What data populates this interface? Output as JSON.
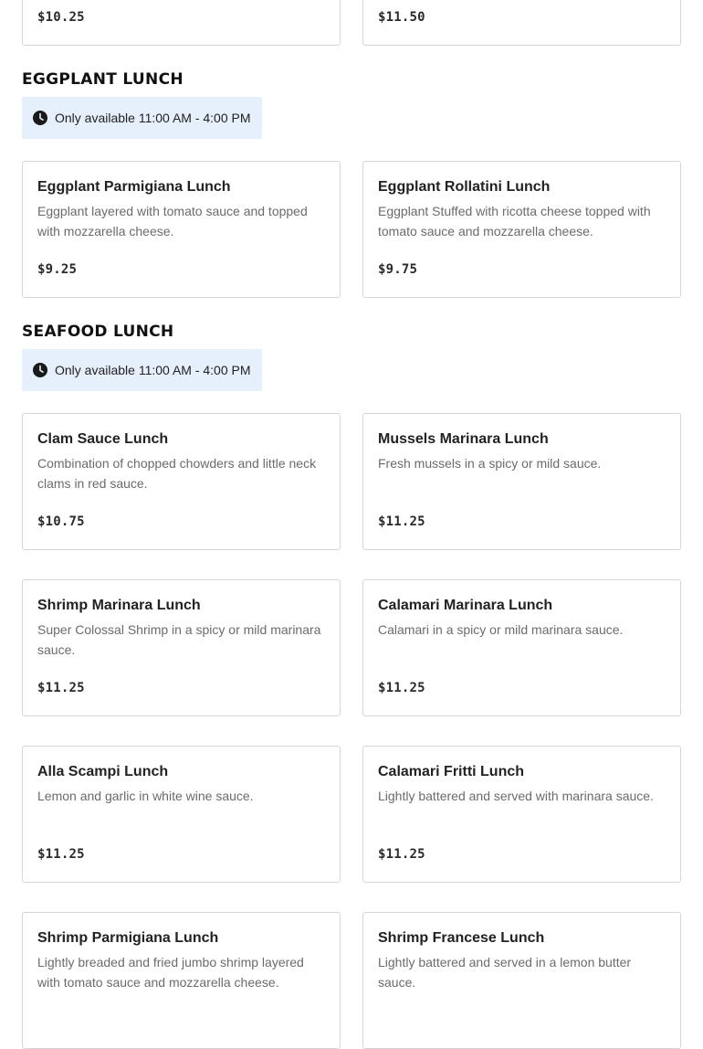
{
  "top_row": [
    {
      "price": "$10.25"
    },
    {
      "price": "$11.50"
    }
  ],
  "sections": [
    {
      "title": "EGGPLANT LUNCH",
      "availability": "Only available 11:00 AM - 4:00 PM",
      "items": [
        {
          "name": "Eggplant Parmigiana Lunch",
          "desc": "Eggplant layered with tomato sauce and topped with mozzarella cheese.",
          "price": "$9.25"
        },
        {
          "name": "Eggplant Rollatini Lunch",
          "desc": "Eggplant Stuffed with ricotta cheese topped with tomato sauce and mozzarella cheese.",
          "price": "$9.75"
        }
      ]
    },
    {
      "title": "SEAFOOD LUNCH",
      "availability": "Only available 11:00 AM - 4:00 PM",
      "items": [
        {
          "name": "Clam Sauce Lunch",
          "desc": "Combination of chopped chowders and little neck clams in red sauce.",
          "price": "$10.75"
        },
        {
          "name": "Mussels Marinara Lunch",
          "desc": "Fresh mussels in a spicy or mild sauce.",
          "price": "$11.25"
        },
        {
          "name": "Shrimp Marinara Lunch",
          "desc": "Super Colossal Shrimp in a spicy or mild marinara sauce.",
          "price": "$11.25"
        },
        {
          "name": "Calamari Marinara Lunch",
          "desc": "Calamari in a spicy or mild marinara sauce.",
          "price": "$11.25"
        },
        {
          "name": "Alla Scampi Lunch",
          "desc": "Lemon and garlic in white wine sauce.",
          "price": "$11.25"
        },
        {
          "name": "Calamari Fritti Lunch",
          "desc": "Lightly battered and served with marinara sauce.",
          "price": "$11.25"
        },
        {
          "name": "Shrimp Parmigiana Lunch",
          "desc": "Lightly breaded and fried jumbo shrimp layered with tomato sauce and mozzarella cheese.",
          "price": ""
        },
        {
          "name": "Shrimp Francese Lunch",
          "desc": "Lightly battered and served in a lemon butter sauce.",
          "price": ""
        }
      ]
    }
  ],
  "icons": {
    "availability": "clock-icon"
  },
  "colors": {
    "availability_bg": "#e6effc",
    "card_border": "#d6d6d6"
  }
}
